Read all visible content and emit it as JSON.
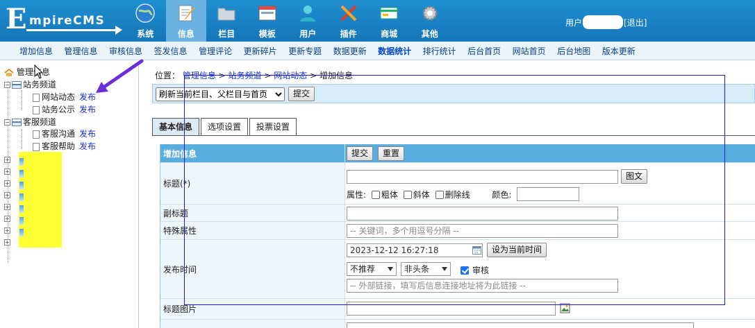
{
  "brand": {
    "e": "E",
    "rest": "mpireCMS"
  },
  "mainnav": [
    {
      "label": "系统",
      "icon": "globe-icon"
    },
    {
      "label": "信息",
      "icon": "notepad-icon",
      "active": true
    },
    {
      "label": "栏目",
      "icon": "folder-icon"
    },
    {
      "label": "模板",
      "icon": "window-icon"
    },
    {
      "label": "用户",
      "icon": "user-icon"
    },
    {
      "label": "插件",
      "icon": "tools-icon"
    },
    {
      "label": "商城",
      "icon": "card-icon"
    },
    {
      "label": "其他",
      "icon": "gear-icon"
    }
  ],
  "user": {
    "prefix": "用户",
    "logout": "[退出]"
  },
  "subnav": [
    "增加信息",
    "管理信息",
    "审核信息",
    "签发信息",
    "管理评论",
    "更新碎片",
    "更新专题",
    "数据更新",
    "数据统计",
    "排行统计",
    "后台首页",
    "网站首页",
    "后台地图",
    "版本更新"
  ],
  "subnav_active": "数据统计",
  "tree": {
    "root": "管理信息",
    "groups": [
      {
        "name": "站务频道",
        "children": [
          {
            "name": "网站动态",
            "pub": "发布"
          },
          {
            "name": "站务公示",
            "pub": "发布"
          }
        ]
      },
      {
        "name": "客服频道",
        "children": [
          {
            "name": "客服沟通",
            "pub": "发布"
          },
          {
            "name": "客服帮助",
            "pub": "发布"
          }
        ]
      }
    ]
  },
  "location": {
    "prefix": "位置：",
    "crumbs": [
      "管理信息",
      "站务频道",
      "网站动态"
    ],
    "sep": " > ",
    "current": "增加信息"
  },
  "refresh": {
    "option": "刷新当前栏目、父栏目与首页",
    "submit": "提交"
  },
  "tabs": [
    "基本信息",
    "选项设置",
    "投票设置"
  ],
  "form": {
    "header": "增加信息",
    "submit": "提交",
    "reset": "重置",
    "title_label": "标题(*)",
    "title_btn": "图文",
    "attr_label": "属性:",
    "attr_bold": "粗体",
    "attr_italic": "斜体",
    "attr_strike": "删除线",
    "color_label": "颜色:",
    "subtitle_label": "副标题",
    "special_label": "特殊属性",
    "special_placeholder": "-- 关键词，多个用逗号分隔 --",
    "pubtime_label": "发布时间",
    "pubtime_value": "2023-12-12 16:27:18",
    "set_now": "设为当前时间",
    "recommend": "不推荐",
    "headline": "非头条",
    "audit": "审核",
    "link_placeholder": "-- 外部链接，填写后信息连接地址将为此链接 --",
    "titlepic_label": "标题图片"
  }
}
